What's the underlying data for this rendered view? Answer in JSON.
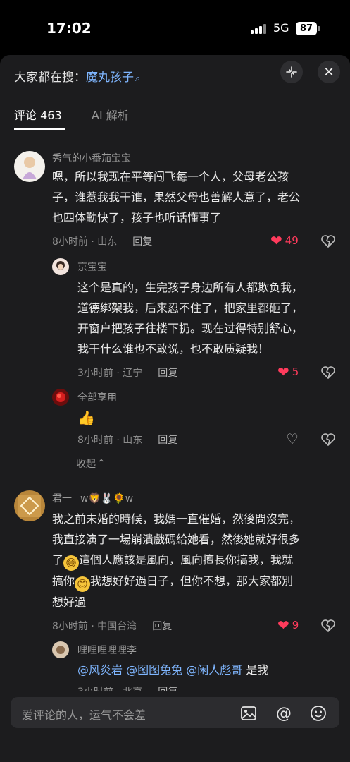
{
  "status_bar": {
    "time": "17:02",
    "network": "5G",
    "battery": "87"
  },
  "search": {
    "prefix": "大家都在搜：",
    "term": "魔丸孩子"
  },
  "tabs": [
    {
      "label": "评论 463"
    },
    {
      "label": "AI 解析"
    }
  ],
  "comments": [
    {
      "author": "秀气的小番茄宝宝",
      "lines": [
        "嗯，所以我现在平等闯飞每一个人，父母老公孩",
        "子，谁惹我我干谁，果然父母也善解人意了，老公",
        "也四体勤快了，孩子也听话懂事了"
      ],
      "meta": "8小时前 · 山东",
      "reply": "回复",
      "likes": "49"
    },
    {
      "author": "京宝宝",
      "lines": [
        "这个是真的，生完孩子身边所有人都欺负我，",
        "道德绑架我，后来忍不住了，把家里都砸了，",
        "开窗户把孩子往楼下扔。现在过得特别舒心，",
        "我干什么谁也不敢说，也不敢质疑我！"
      ],
      "meta": "3小时前 · 辽宁",
      "reply": "回复",
      "likes": "5"
    },
    {
      "author": "全部享用",
      "emoji": "👍",
      "meta": "8小时前 · 山东",
      "reply": "回复"
    },
    {
      "author": "君一",
      "author_suffix": "w🦁🐰🌻w",
      "line1": "我之前未婚的時候，我媽一直催婚，然後問沒完，",
      "line2": "我直接演了一場崩潰戲碼給她看，然後她就好很多",
      "line3_a": "了",
      "line3_b": "這個人應該是風向，風向擅長你搞我，我就",
      "line4_a": "搞你",
      "line4_b": "我想好好過日子，但你不想，那大家都別",
      "line5": "想好過",
      "meta": "8小时前 · 中国台湾",
      "reply": "回复",
      "likes": "9"
    },
    {
      "author": "哩哩哩哩哩李",
      "mentions": [
        "@风炎岩",
        "@图图兔兔",
        "@闲人彪哥"
      ],
      "tail": "是我",
      "meta": "3小时前 · 北京",
      "reply": "回复"
    }
  ],
  "collapse_label": "收起",
  "input": {
    "placeholder": "爱评论的人，运气不会差"
  }
}
